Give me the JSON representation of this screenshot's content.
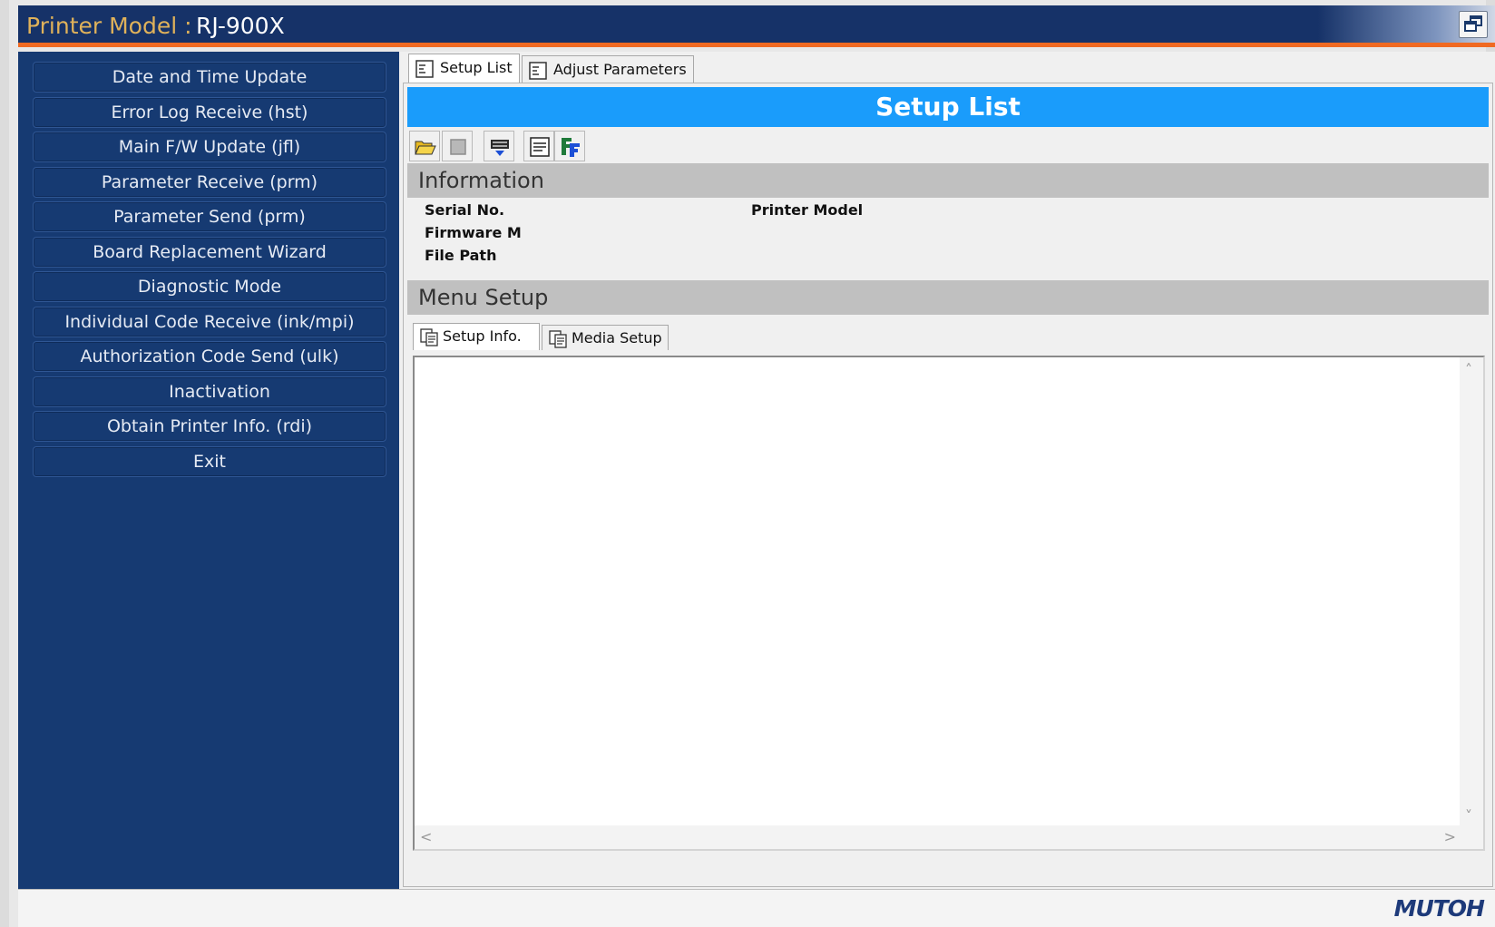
{
  "titlebar": {
    "label": "Printer Model :",
    "model": "RJ-900X"
  },
  "sidebar": {
    "items": [
      {
        "label": "Date and Time Update"
      },
      {
        "label": "Error Log Receive (hst)"
      },
      {
        "label": "Main F/W Update (jfl)"
      },
      {
        "label": "Parameter Receive (prm)"
      },
      {
        "label": "Parameter Send (prm)"
      },
      {
        "label": "Board Replacement Wizard"
      },
      {
        "label": "Diagnostic Mode"
      },
      {
        "label": "Individual Code Receive (ink/mpi)"
      },
      {
        "label": "Authorization Code Send (ulk)"
      },
      {
        "label": "Inactivation"
      },
      {
        "label": "Obtain Printer Info. (rdi)"
      },
      {
        "label": "Exit"
      }
    ]
  },
  "tabs": [
    {
      "label": "Setup List",
      "active": true
    },
    {
      "label": "Adjust Parameters",
      "active": false
    }
  ],
  "setup_list": {
    "header": "Setup List",
    "information_title": "Information",
    "fields": {
      "serial_no": "Serial No.",
      "firmware": "Firmware M",
      "file_path": "File Path",
      "printer_model": "Printer Model"
    },
    "menu_setup_title": "Menu Setup",
    "sub_tabs": [
      {
        "label": "Setup Info.",
        "active": true
      },
      {
        "label": "Media Setup",
        "active": false
      }
    ]
  },
  "icons": {
    "restore": "restore-window-icon",
    "toolbar": [
      "open-folder-icon",
      "stop-icon",
      "printer-icon",
      "document-icon",
      "font-icon"
    ]
  },
  "colors": {
    "titlebar_bg": "#163268",
    "accent_orange": "#f06a22",
    "sidebar_bg": "#163a72",
    "header_blue": "#1a9cfb",
    "section_gray": "#c0c0c0"
  },
  "statusbar": {
    "logo": "MUTOH"
  }
}
